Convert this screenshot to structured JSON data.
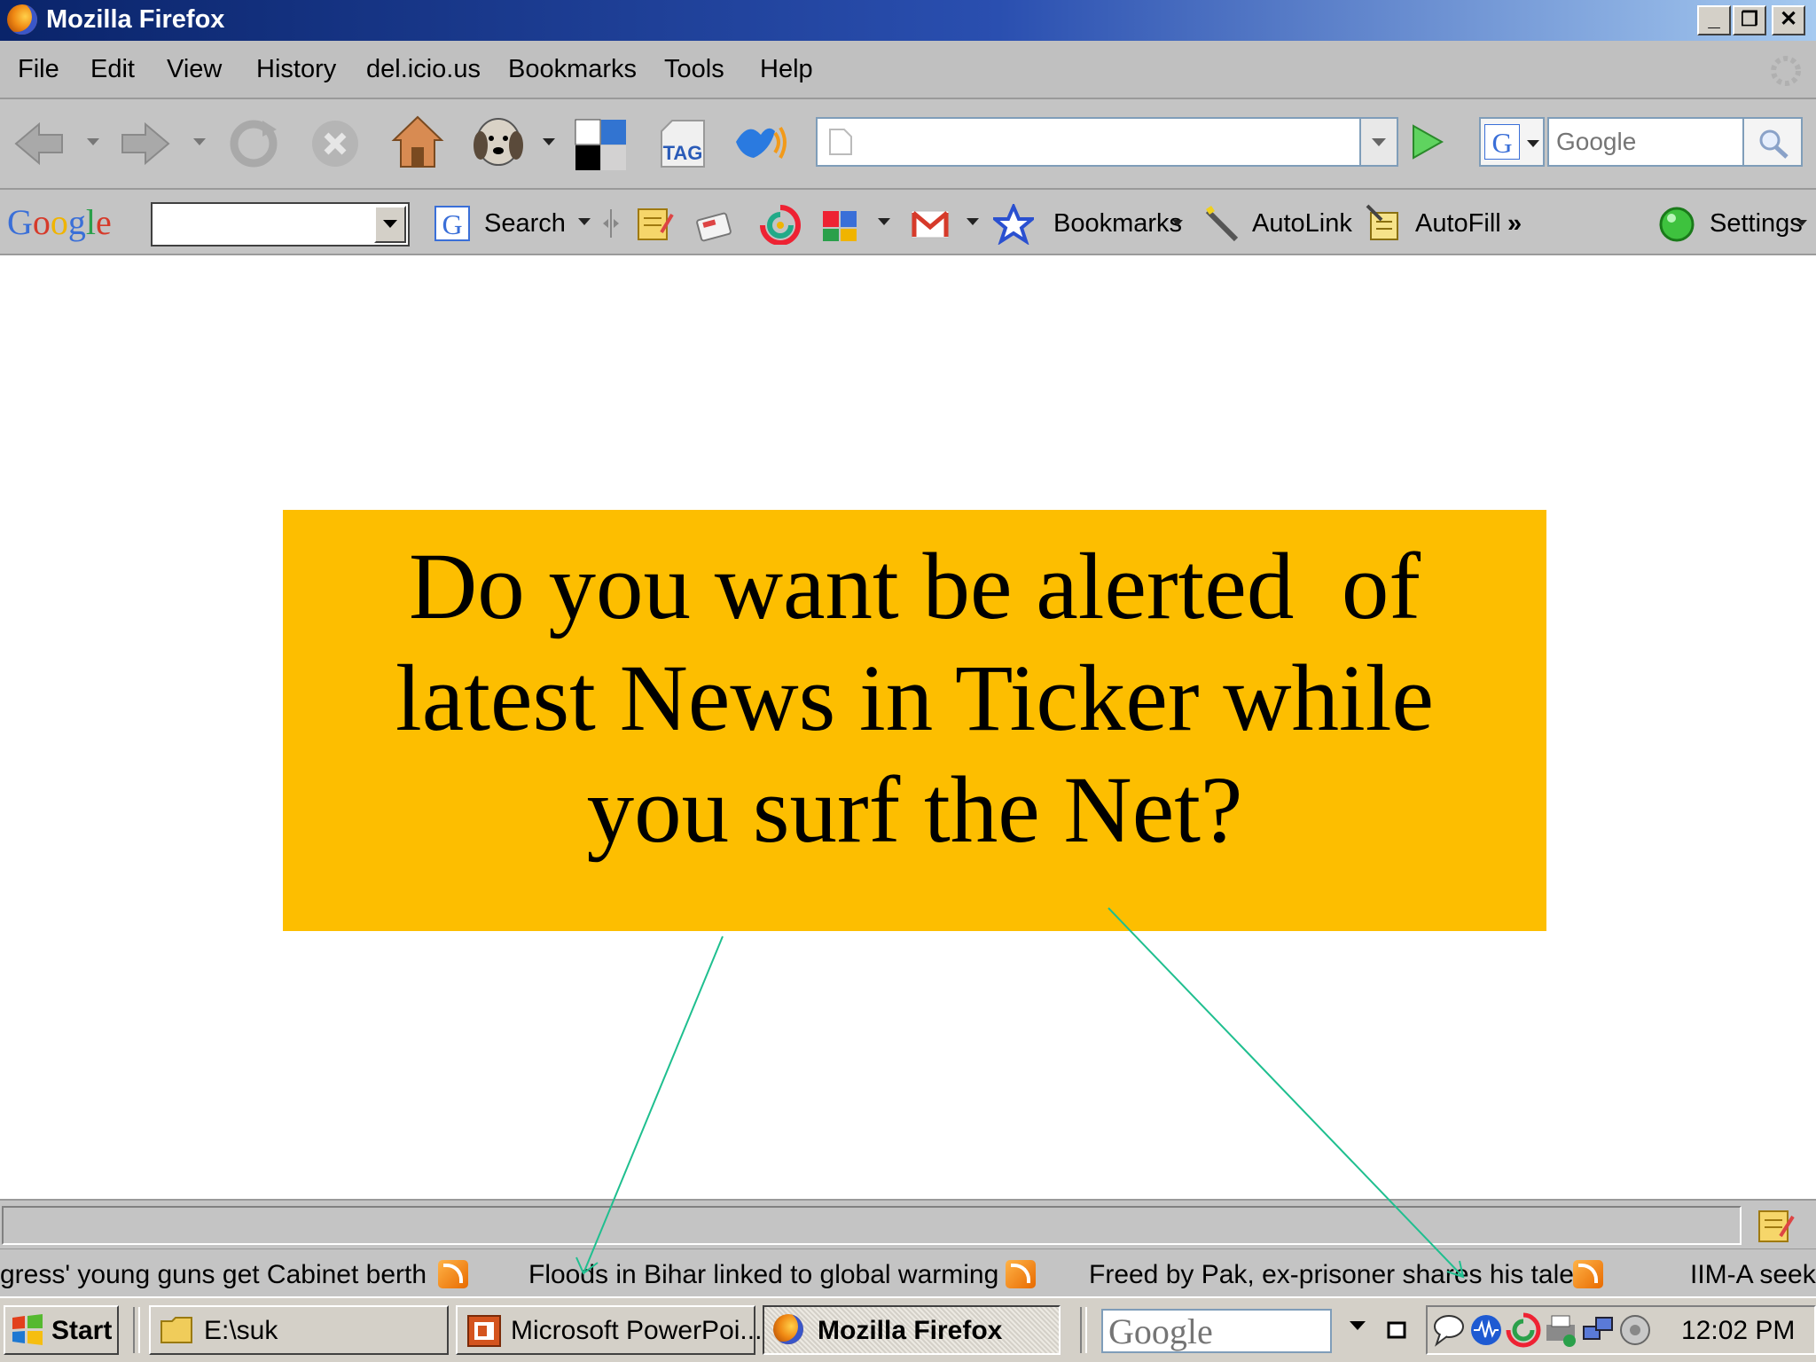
{
  "window": {
    "title": "Mozilla Firefox",
    "controls": [
      "minimize",
      "restore",
      "close"
    ]
  },
  "menu": [
    "File",
    "Edit",
    "View",
    "History",
    "del.icio.us",
    "Bookmarks",
    "Tools",
    "Help"
  ],
  "navbar": {
    "url_value": "",
    "search_placeholder": "Google"
  },
  "google_toolbar": {
    "logo": "Google",
    "search_label": "Search",
    "bookmarks_label": "Bookmarks",
    "autolink_label": "AutoLink",
    "autofill_label": "AutoFill",
    "more_label": "»",
    "settings_label": "Settings"
  },
  "callout": {
    "line1": "Do you want be alerted  of",
    "line2": "latest News in Ticker while",
    "line3": "you surf the Net?"
  },
  "ticker": {
    "items": [
      "gress' young guns get Cabinet berth",
      "Floods in Bihar linked to global warming",
      "Freed by Pak, ex-prisoner shares his tale",
      "IIM-A seeks"
    ]
  },
  "taskbar": {
    "start_label": "Start",
    "buttons": [
      "E:\\suk",
      "Microsoft PowerPoi...",
      "Mozilla Firefox"
    ],
    "google_search_placeholder": "Google",
    "clock": "12:02 PM"
  },
  "colors": {
    "callout_bg": "#fdbe00",
    "arrow": "#1fbf8f",
    "titlebar": "#0a246a"
  }
}
